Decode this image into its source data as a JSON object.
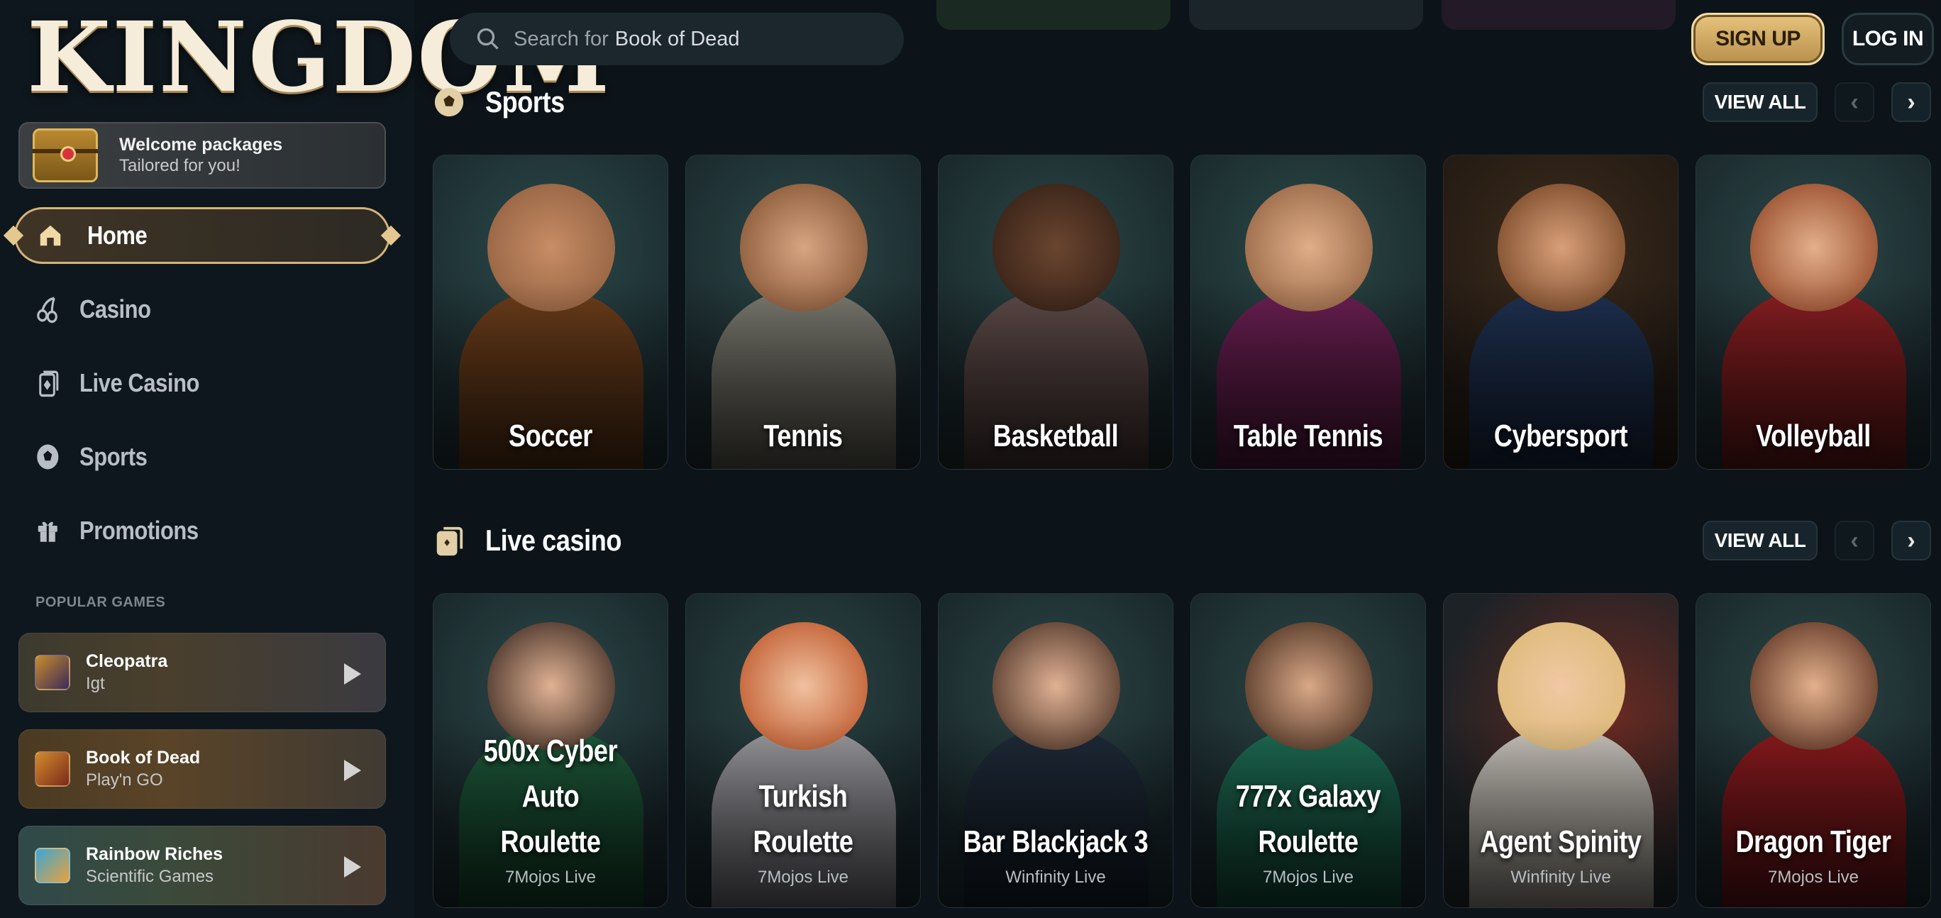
{
  "brand": {
    "logo_text": "KINGDOM"
  },
  "welcome": {
    "title": "Welcome packages",
    "subtitle": "Tailored for you!"
  },
  "nav": [
    {
      "label": "Home",
      "icon": "home-icon",
      "active": true
    },
    {
      "label": "Casino",
      "icon": "cherries-icon",
      "active": false
    },
    {
      "label": "Live Casino",
      "icon": "cards-icon",
      "active": false
    },
    {
      "label": "Sports",
      "icon": "soccer-ball-icon",
      "active": false
    },
    {
      "label": "Promotions",
      "icon": "gift-icon",
      "active": false
    }
  ],
  "popular": {
    "heading": "POPULAR GAMES",
    "games": [
      {
        "title": "Cleopatra",
        "provider": "Igt"
      },
      {
        "title": "Book of Dead",
        "provider": "Play'n GO"
      },
      {
        "title": "Rainbow Riches",
        "provider": "Scientific Games"
      }
    ]
  },
  "search": {
    "prefix": "Search for",
    "value": "Book of Dead"
  },
  "auth": {
    "signup": "SIGN UP",
    "login": "LOG IN"
  },
  "sections": {
    "sports": {
      "title": "Sports",
      "view_all": "VIEW ALL",
      "items": [
        {
          "name": "Soccer"
        },
        {
          "name": "Tennis"
        },
        {
          "name": "Basketball"
        },
        {
          "name": "Table Tennis"
        },
        {
          "name": "Cybersport"
        },
        {
          "name": "Volleyball"
        }
      ]
    },
    "live_casino": {
      "title": "Live casino",
      "view_all": "VIEW ALL",
      "items": [
        {
          "line1": "500x Cyber Auto",
          "line2": "Roulette",
          "provider": "7Mojos Live"
        },
        {
          "line1": "",
          "line2": "Turkish Roulette",
          "provider": "7Mojos Live"
        },
        {
          "line1": "",
          "line2": "Bar Blackjack 3",
          "provider": "Winfinity Live"
        },
        {
          "line1": "777x Galaxy",
          "line2": "Roulette",
          "provider": "7Mojos Live"
        },
        {
          "line1": "",
          "line2": "Agent Spinity",
          "provider": "Winfinity Live"
        },
        {
          "line1": "",
          "line2": "Dragon Tiger",
          "provider": "7Mojos Live"
        }
      ]
    }
  },
  "colors": {
    "accent_gold": "#d5b47a",
    "background": "#0c1419",
    "sidebar": "#0e171d"
  }
}
